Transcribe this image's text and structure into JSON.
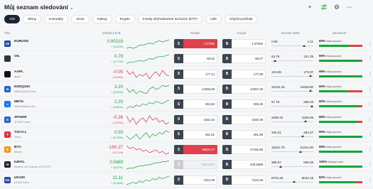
{
  "header": {
    "title": "Můj seznam sledování",
    "icons": [
      "add-icon",
      "sliders-icon",
      "settings-icon",
      "more-icon"
    ]
  },
  "filters": [
    "Vše",
    "Mény",
    "Komodity",
    "Akcie",
    "Indexy",
    "Krypto",
    "Fondy obchodované na burze (ETF)",
    "Lidé",
    "Chytrá portfolia"
  ],
  "columns": {
    "markets": "Trhy",
    "change": "Změnit",
    "change_period": "1 D",
    "sell": "Prodat",
    "buy": "Koupit",
    "range": "Rozsah 1DNI",
    "sentiment": "Sentiment"
  },
  "colors": {
    "up": "#13a538",
    "down": "#e2333d"
  },
  "rows": [
    {
      "symbol": "EURUSD",
      "name": "",
      "change": "0.00219",
      "pct": "+ (0.20%)",
      "dir": "up",
      "sell": "1.07085",
      "buy": "1.07094",
      "low": "0.95",
      "high": "1.11",
      "range_level": 0.78,
      "sent_pct": "69%",
      "sent_label": "Nakupování",
      "sent_value": 69,
      "sell_style": "hi",
      "spark": [
        5,
        6,
        5,
        6,
        8,
        8,
        9,
        10,
        9,
        11,
        12,
        11,
        12,
        13
      ],
      "logo": "€$",
      "logo_color": "#1e4ba8"
    },
    {
      "symbol": "OIL",
      "name": "",
      "change": "0.79",
      "pct": "+ (1.17%)",
      "dir": "up",
      "sell": "68.42",
      "buy": "68.47",
      "low": "63.76",
      "high": "121.39",
      "range_level": 0.08,
      "sent_pct": "96%",
      "sent_label": "Nakupování",
      "sent_value": 96,
      "sell_style": "",
      "spark": [
        4,
        5,
        5,
        6,
        7,
        6,
        7,
        9,
        8,
        10,
        11,
        11,
        12,
        13
      ],
      "logo": "",
      "logo_color": "#2e3540"
    },
    {
      "symbol": "AAPL",
      "name": "Apple",
      "change": "-0.05",
      "pct": "- (-0.03%)",
      "dir": "down",
      "sell": "177.14",
      "buy": "177.69",
      "low": "123.99",
      "high": "179.07",
      "range_level": 0.93,
      "sent_pct": "98%",
      "sent_label": "Nakupování",
      "sent_value": 98,
      "sell_style": "",
      "spark": [
        12,
        9,
        11,
        7,
        9,
        8,
        10,
        6,
        9,
        11,
        8,
        12,
        9,
        8
      ],
      "logo": "",
      "logo_color": "#111418"
    },
    {
      "symbol": "NSDQ100",
      "name": "NASDAQ100 Index",
      "change": "3.20",
      "pct": "+ (0.02%)",
      "dir": "up",
      "sell": "14255.00",
      "buy": "14257.48",
      "low": "10431.45",
      "high": "14528.90",
      "range_level": 0.94,
      "sent_pct": "66%",
      "sent_label": "Nakupování",
      "sent_value": 66,
      "sell_style": "",
      "spark": [
        10,
        7,
        9,
        6,
        8,
        7,
        6,
        9,
        11,
        9,
        10,
        12,
        11,
        12
      ],
      "logo": "N",
      "logo_color": "#2a64c5"
    },
    {
      "symbol": "META",
      "name": "Meta Platforms Inc",
      "change": "2.20",
      "pct": "+ (0.84%)",
      "dir": "up",
      "sell": "264.53",
      "buy": "265.35",
      "low": "87.76",
      "high": "268.18",
      "range_level": 0.97,
      "sent_pct": "90%",
      "sent_label": "Nakupování",
      "sent_value": 90,
      "sell_style": "",
      "spark": [
        6,
        8,
        7,
        9,
        8,
        10,
        9,
        11,
        10,
        12,
        11,
        10,
        12,
        13
      ],
      "logo": "∞",
      "logo_color": "#1877f2"
    },
    {
      "symbol": "SPX500",
      "name": "SPX500 Index",
      "change": "-0.26",
      "pct": "- (-0.01%)",
      "dir": "down",
      "sell": "4181.64",
      "buy": "4182.39",
      "low": "3490.42",
      "high": "4326.99",
      "range_level": 0.82,
      "sent_pct": "88%",
      "sent_label": "Nakupování",
      "sent_value": 88,
      "sell_style": "",
      "spark": [
        11,
        8,
        10,
        7,
        9,
        10,
        8,
        11,
        9,
        10,
        8,
        9,
        7,
        8
      ],
      "logo": "S",
      "logo_color": "#2a64c5"
    },
    {
      "symbol": "TSCO.L",
      "name": "Tesco",
      "change": "0.50",
      "pct": "+ (0.19%)",
      "dir": "up",
      "sell": "261.01",
      "buy": "261.99",
      "low": "194.31",
      "high": "284.47",
      "range_level": 0.74,
      "sent_pct": "99%",
      "sent_label": "Nakupování",
      "sent_value": 99,
      "sell_style": "",
      "spark": [
        9,
        7,
        8,
        10,
        7,
        9,
        11,
        8,
        10,
        9,
        11,
        10,
        12,
        11
      ],
      "logo": "T",
      "logo_color": "#e2333d"
    },
    {
      "symbol": "BTC",
      "name": "Bitcoin",
      "change": "-190.27",
      "pct": "- (-0.71%)",
      "dir": "down",
      "sell": "26634.47",
      "buy": "27191.86",
      "low": "15312.76",
      "high": "31421.90",
      "range_level": 0.7,
      "sent_pct": "99%",
      "sent_label": "Nakupování",
      "sent_value": 99,
      "sell_style": "hi",
      "spark": [
        12,
        10,
        11,
        9,
        10,
        8,
        9,
        7,
        8,
        9,
        7,
        8,
        6,
        7
      ],
      "logo": "₿",
      "logo_color": "#f7931a"
    },
    {
      "symbol": "IUKP.L",
      "name": "iShares UK Property UCITS ETF",
      "change": "2.0469",
      "pct": "+ (0.47%)",
      "dir": "up",
      "sell": "438.4910",
      "buy": "440.5599",
      "low": "388.87",
      "high": "609.35",
      "range_level": 0.22,
      "sent_pct": "100%",
      "sent_label": "Nakupování",
      "sent_value": 100,
      "sell_style": "dim",
      "spark": [
        5,
        6,
        6,
        7,
        8,
        8,
        9,
        9,
        10,
        11,
        11,
        12,
        12,
        13
      ],
      "logo": "iS",
      "logo_color": "#222"
    },
    {
      "symbol": "UK100",
      "name": "UK100 Index",
      "change": "11.11",
      "pct": "+ (0.15%)",
      "dir": "up",
      "sell": "7444.29",
      "buy": "7444.29",
      "low": "6704.46",
      "high": "8044.19",
      "range_level": 0.55,
      "sent_pct": "82%",
      "sent_label": "Nakupování",
      "sent_value": 82,
      "sell_style": "",
      "spark": [
        6,
        7,
        8,
        7,
        9,
        8,
        10,
        9,
        11,
        10,
        12,
        11,
        12,
        13
      ],
      "logo": "UK",
      "logo_color": "#1e4ba8"
    }
  ],
  "trade": {
    "sell_btn": "S",
    "buy_btn": "B"
  }
}
